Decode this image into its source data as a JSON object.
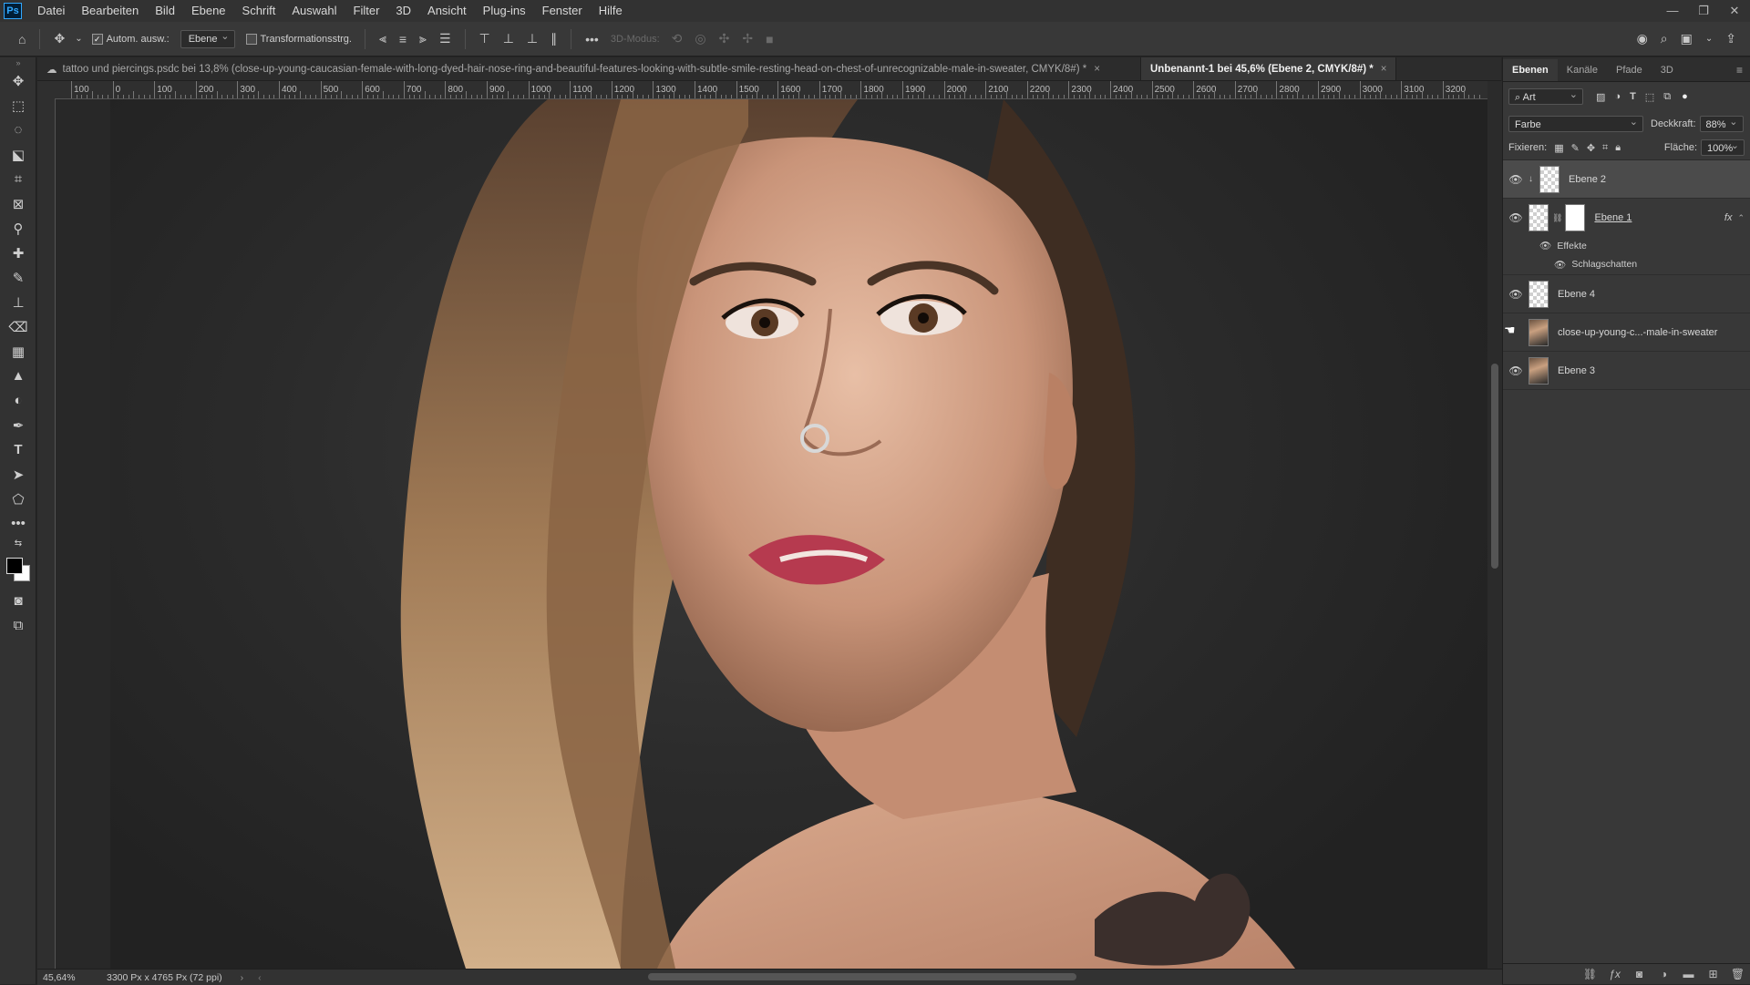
{
  "app": {
    "logo": "Ps"
  },
  "menu": [
    "Datei",
    "Bearbeiten",
    "Bild",
    "Ebene",
    "Schrift",
    "Auswahl",
    "Filter",
    "3D",
    "Ansicht",
    "Plug-ins",
    "Fenster",
    "Hilfe"
  ],
  "options": {
    "auto_select_label": "Autom. ausw.:",
    "auto_select_target": "Ebene",
    "transform_controls_label": "Transformationsstrg.",
    "mode_3d_label": "3D-Modus:",
    "more": "•••"
  },
  "tabs": [
    {
      "label": "tattoo und piercings.psdc bei 13,8% (close-up-young-caucasian-female-with-long-dyed-hair-nose-ring-and-beautiful-features-looking-with-subtle-smile-resting-head-on-chest-of-unrecognizable-male-in-sweater, CMYK/8#) *",
      "active": false
    },
    {
      "label": "Unbenannt-1 bei 45,6% (Ebene 2, CMYK/8#) *",
      "active": true
    }
  ],
  "ruler": {
    "h_labels": [
      "100",
      "0",
      "100",
      "200",
      "300",
      "400",
      "500",
      "600",
      "700",
      "800",
      "900",
      "1000",
      "1100",
      "1200",
      "1300",
      "1400",
      "1500",
      "1600",
      "1700",
      "1800",
      "1900",
      "2000",
      "2100",
      "2200",
      "2300",
      "2400",
      "2500",
      "2600",
      "2700",
      "2800",
      "2900",
      "3000",
      "3100",
      "3200"
    ]
  },
  "status": {
    "zoom": "45,64%",
    "dimensions": "3300 Px x 4765 Px (72 ppi)"
  },
  "panel": {
    "tabs": [
      "Ebenen",
      "Kanäle",
      "Pfade",
      "3D"
    ],
    "filter_kind": "Art",
    "blend_mode": "Farbe",
    "opacity_label": "Deckkraft:",
    "opacity_value": "88%",
    "lock_label": "Fixieren:",
    "fill_label": "Fläche:",
    "fill_value": "100%",
    "layers": [
      {
        "name": "Ebene 2",
        "visible": true,
        "selected": true,
        "thumb": "checker"
      },
      {
        "name": "Ebene 1",
        "visible": true,
        "selected": false,
        "thumb": "checker",
        "mask": true,
        "fx": "fx"
      },
      {
        "name": "Ebene 4",
        "visible": true,
        "selected": false,
        "thumb": "checker"
      },
      {
        "name": "close-up-young-c...-male-in-sweater",
        "visible": false,
        "selected": false,
        "thumb": "photo"
      },
      {
        "name": "Ebene 3",
        "visible": true,
        "selected": false,
        "thumb": "photo"
      }
    ],
    "effects_label": "Effekte",
    "drop_shadow_label": "Schlagschatten"
  }
}
